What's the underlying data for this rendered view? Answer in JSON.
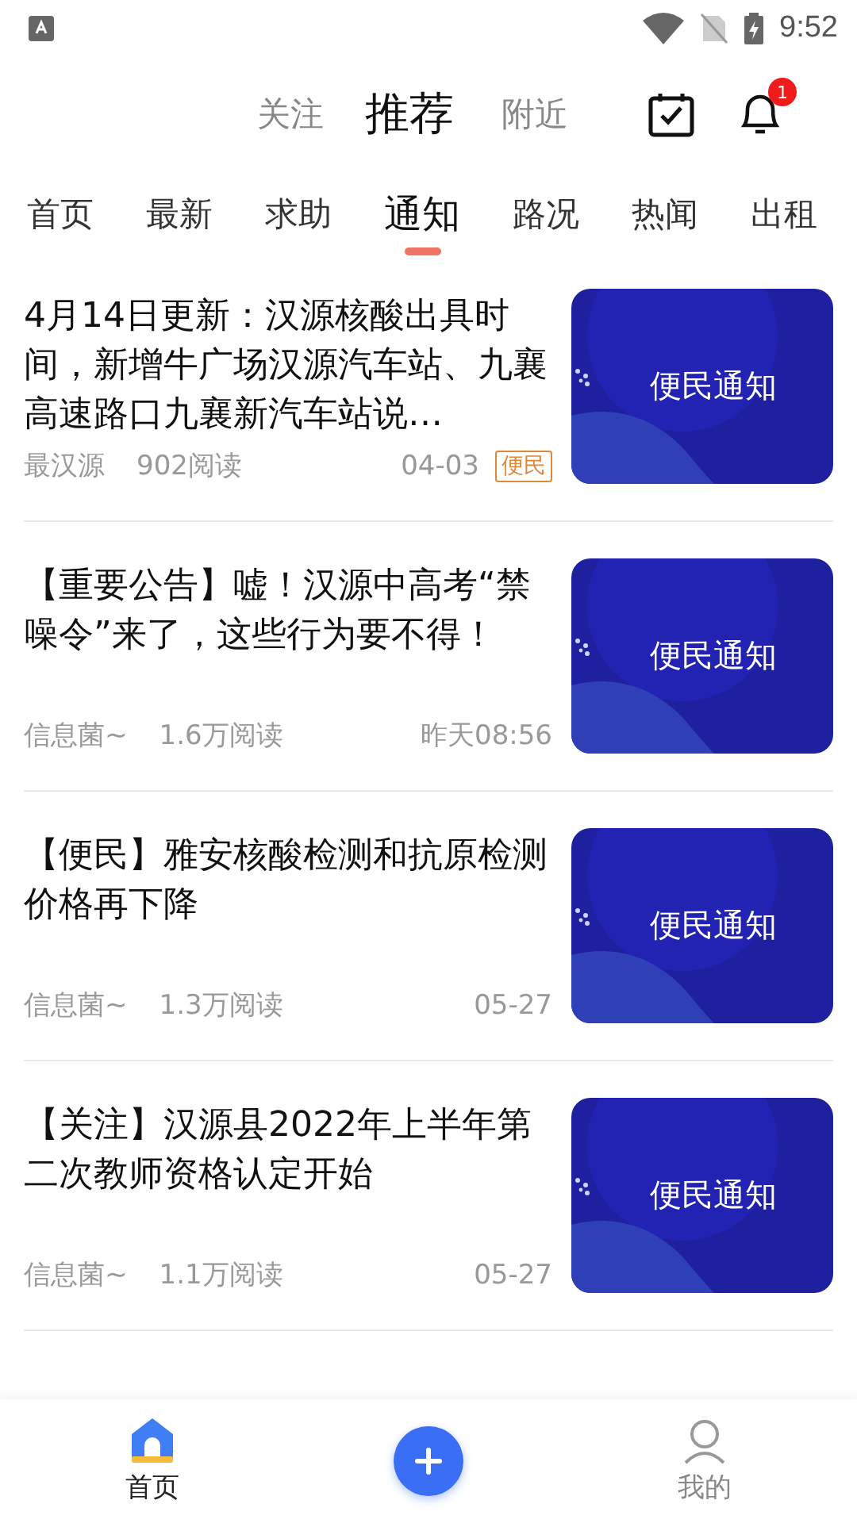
{
  "status_bar": {
    "time": "9:52"
  },
  "top_tabs": [
    {
      "label": "关注",
      "selected": false
    },
    {
      "label": "推荐",
      "selected": true
    },
    {
      "label": "附近",
      "selected": false
    }
  ],
  "notification_badge": "1",
  "category_tabs": [
    {
      "label": "首页",
      "selected": false
    },
    {
      "label": "最新",
      "selected": false
    },
    {
      "label": "求助",
      "selected": false
    },
    {
      "label": "通知",
      "selected": true
    },
    {
      "label": "路况",
      "selected": false
    },
    {
      "label": "热闻",
      "selected": false
    },
    {
      "label": "出租",
      "selected": false
    }
  ],
  "articles": [
    {
      "title": "4月14日更新：汉源核酸出具时间，新增牛广场汉源汽车站、九襄高速路口九襄新汽车站说…",
      "source": "最汉源",
      "reads": "902阅读",
      "time": "04-03",
      "tag": "便民",
      "thumb_label": "便民通知"
    },
    {
      "title": "【重要公告】嘘！汉源中高考“禁噪令”来了，这些行为要不得！",
      "source": "信息菌~",
      "reads": "1.6万阅读",
      "time": "昨天08:56",
      "thumb_label": "便民通知"
    },
    {
      "title": "【便民】雅安核酸检测和抗原检测价格再下降",
      "source": "信息菌~",
      "reads": "1.3万阅读",
      "time": "05-27",
      "thumb_label": "便民通知"
    },
    {
      "title": "【关注】汉源县2022年上半年第二次教师资格认定开始",
      "source": "信息菌~",
      "reads": "1.1万阅读",
      "time": "05-27",
      "thumb_label": "便民通知"
    }
  ],
  "bottom_nav": [
    {
      "kind": "tab",
      "label": "首页",
      "selected": true
    },
    {
      "kind": "add"
    },
    {
      "kind": "tab",
      "label": "我的",
      "selected": false
    }
  ]
}
